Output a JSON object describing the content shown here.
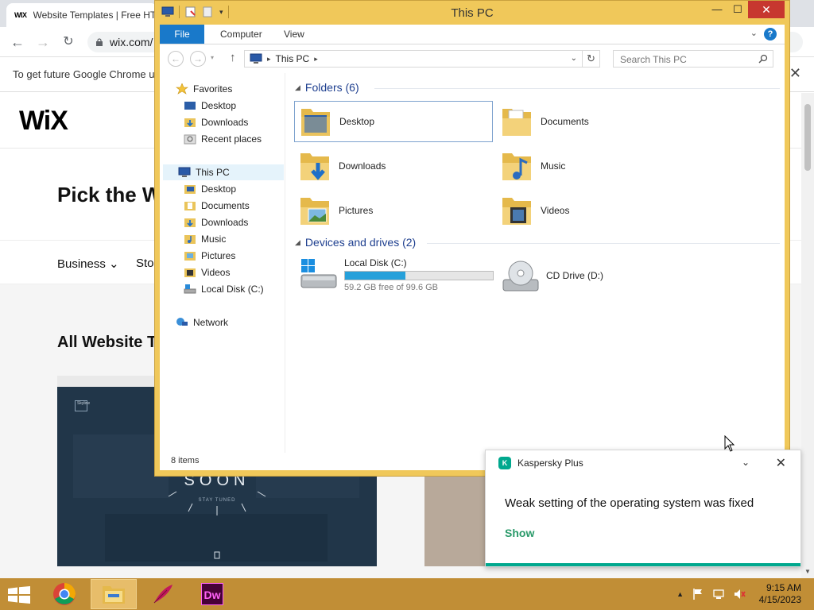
{
  "browser": {
    "tab_title": "Website Templates | Free HT",
    "tab_favicon_text": "WIX",
    "url": "wix.com/",
    "infobar_text": "To get future Google Chrome u"
  },
  "wix": {
    "logo": "WiX",
    "heading": "Pick the W",
    "categories": [
      "Business",
      "Sto"
    ],
    "section_title": "All Website T",
    "template_text": "SOON",
    "template_sub": "STAY TUNED",
    "template_label": "Skyline"
  },
  "explorer": {
    "title": "This PC",
    "ribbon_tabs": [
      "File",
      "Computer",
      "View"
    ],
    "help_label": "?",
    "address": "This PC",
    "search_placeholder": "Search This PC",
    "nav": {
      "favorites": {
        "label": "Favorites",
        "items": [
          "Desktop",
          "Downloads",
          "Recent places"
        ]
      },
      "this_pc": {
        "label": "This PC",
        "items": [
          "Desktop",
          "Documents",
          "Downloads",
          "Music",
          "Pictures",
          "Videos",
          "Local Disk (C:)"
        ]
      },
      "network": "Network"
    },
    "folders_header": "Folders (6)",
    "folders": [
      "Desktop",
      "Documents",
      "Downloads",
      "Music",
      "Pictures",
      "Videos"
    ],
    "drives_header": "Devices and drives (2)",
    "drives": [
      {
        "name": "Local Disk (C:)",
        "free": "59.2 GB free of 99.6 GB",
        "used_fraction": 0.406
      },
      {
        "name": "CD Drive (D:)"
      }
    ],
    "status": "8 items"
  },
  "toast": {
    "app": "Kaspersky Plus",
    "logo": "K",
    "message": "Weak setting of the operating system was fixed",
    "action": "Show"
  },
  "taskbar": {
    "apps": [
      "chrome-icon",
      "file-explorer-icon",
      "feather-app-icon",
      "dreamweaver-icon"
    ],
    "dw_label": "Dw",
    "time": "9:15 AM",
    "date": "4/15/2023"
  },
  "colors": {
    "explorer_frame": "#f0c85a",
    "taskbar": "#c18e36",
    "accent_blue": "#1979ca",
    "kaspersky_green": "#00a88e",
    "drive_bar": "#26a0da"
  }
}
